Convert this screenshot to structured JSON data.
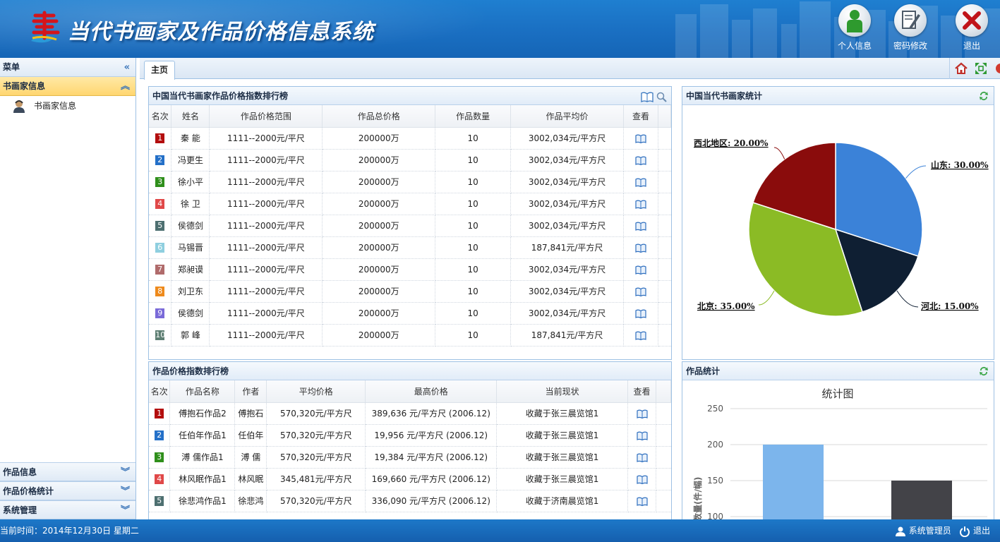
{
  "header": {
    "title": "当代书画家及作品价格信息系统",
    "buttons": [
      {
        "label": "个人信息",
        "icon": "user-icon"
      },
      {
        "label": "密码修改",
        "icon": "edit-icon"
      },
      {
        "label": "退出",
        "icon": "close-icon"
      }
    ]
  },
  "sidebar": {
    "menu_label": "菜单",
    "collapse_icon": "double-chevron-left-icon",
    "active_section": "书画家信息",
    "items": [
      {
        "label": "书画家信息",
        "icon": "artist-avatar-icon"
      }
    ],
    "bottom_sections": [
      "作品信息",
      "作品价格统计",
      "系统管理"
    ]
  },
  "tabs": [
    {
      "label": "主页",
      "active": true
    }
  ],
  "rank_panel": {
    "title": "中国当代书画家作品价格指数排行榜",
    "columns": [
      "名次",
      "姓名",
      "作品价格范围",
      "作品总价格",
      "作品数量",
      "作品平均价",
      "查看"
    ],
    "rows": [
      {
        "rank": "1",
        "name": "秦  能",
        "range": "1111--2000元/平尺",
        "total": "200000万",
        "count": "10",
        "avg": "3002,034元/平方尺"
      },
      {
        "rank": "2",
        "name": "冯更生",
        "range": "1111--2000元/平尺",
        "total": "200000万",
        "count": "10",
        "avg": "3002,034元/平方尺"
      },
      {
        "rank": "3",
        "name": "徐小平",
        "range": "1111--2000元/平尺",
        "total": "200000万",
        "count": "10",
        "avg": "3002,034元/平方尺"
      },
      {
        "rank": "4",
        "name": "徐  卫",
        "range": "1111--2000元/平尺",
        "total": "200000万",
        "count": "10",
        "avg": "3002,034元/平方尺"
      },
      {
        "rank": "5",
        "name": "侯德剑",
        "range": "1111--2000元/平尺",
        "total": "200000万",
        "count": "10",
        "avg": "3002,034元/平方尺"
      },
      {
        "rank": "6",
        "name": "马锡晋",
        "range": "1111--2000元/平尺",
        "total": "200000万",
        "count": "10",
        "avg": "187,841元/平方尺"
      },
      {
        "rank": "7",
        "name": "郑昶谟",
        "range": "1111--2000元/平尺",
        "total": "200000万",
        "count": "10",
        "avg": "3002,034元/平方尺"
      },
      {
        "rank": "8",
        "name": "刘卫东",
        "range": "1111--2000元/平尺",
        "total": "200000万",
        "count": "10",
        "avg": "3002,034元/平方尺"
      },
      {
        "rank": "9",
        "name": "侯德剑",
        "range": "1111--2000元/平尺",
        "total": "200000万",
        "count": "10",
        "avg": "3002,034元/平方尺"
      },
      {
        "rank": "10",
        "name": "郭  峰",
        "range": "1111--2000元/平尺",
        "total": "200000万",
        "count": "10",
        "avg": "187,841元/平方尺"
      }
    ]
  },
  "works_panel": {
    "title": "作品价格指数排行榜",
    "columns": [
      "名次",
      "作品名称",
      "作者",
      "平均价格",
      "最高价格",
      "当前现状",
      "查看"
    ],
    "rows": [
      {
        "rank": "1",
        "work": "傅抱石作品2",
        "author": "傅抱石",
        "avg": "570,320元/平方尺",
        "max": "389,636 元/平方尺 (2006.12)",
        "status": "收藏于张三晨览馆1"
      },
      {
        "rank": "2",
        "work": "任伯年作品1",
        "author": "任伯年",
        "avg": "570,320元/平方尺",
        "max": "19,956 元/平方尺 (2006.12)",
        "status": "收藏于张三晨览馆1"
      },
      {
        "rank": "3",
        "work": "溥 儒作品1",
        "author": "溥  儒",
        "avg": "570,320元/平方尺",
        "max": "19,384 元/平方尺 (2006.12)",
        "status": "收藏于张三晨览馆1"
      },
      {
        "rank": "4",
        "work": "林风眠作品1",
        "author": "林风眠",
        "avg": "345,481元/平方尺",
        "max": "169,660 元/平方尺 (2006.12)",
        "status": "收藏于张三晨览馆1"
      },
      {
        "rank": "5",
        "work": "徐悲鸿作品1",
        "author": "徐悲鸿",
        "avg": "570,320元/平方尺",
        "max": "336,090 元/平方尺 (2006.12)",
        "status": "收藏于济南晨览馆1"
      }
    ]
  },
  "rank_colors": [
    "#b30d0d",
    "#2470c8",
    "#2f8f1b",
    "#e04848",
    "#4d6f70",
    "#8fcfdf",
    "#b06b6b",
    "#ee8a1c",
    "#7a6ad8",
    "#5e7f73"
  ],
  "pie_panel": {
    "title": "中国当代书画家统计",
    "chart_data": {
      "type": "pie",
      "slices": [
        {
          "label": "山东: 30.00%",
          "value": 30,
          "color": "#3b82d8"
        },
        {
          "label": "河北: 15.00%",
          "value": 15,
          "color": "#0f1f33"
        },
        {
          "label": "北京: 35.00%",
          "value": 35,
          "color": "#8bbb25"
        },
        {
          "label": "西北地区: 20.00%",
          "value": 20,
          "color": "#8a0c0c"
        }
      ]
    }
  },
  "bar_panel": {
    "title": "作品统计",
    "chart_data": {
      "type": "bar",
      "title": "统计图",
      "ylabel": "数量(件/幅)",
      "yticks": [
        "250",
        "200",
        "150",
        "100"
      ],
      "ylim": [
        100,
        250
      ],
      "values": [
        200,
        150
      ],
      "colors": [
        "#7cb5ec",
        "#434348"
      ]
    }
  },
  "footer": {
    "time": "当前时间：2014年12月30日 星期二",
    "user": "系统管理员",
    "logout": "退出"
  }
}
